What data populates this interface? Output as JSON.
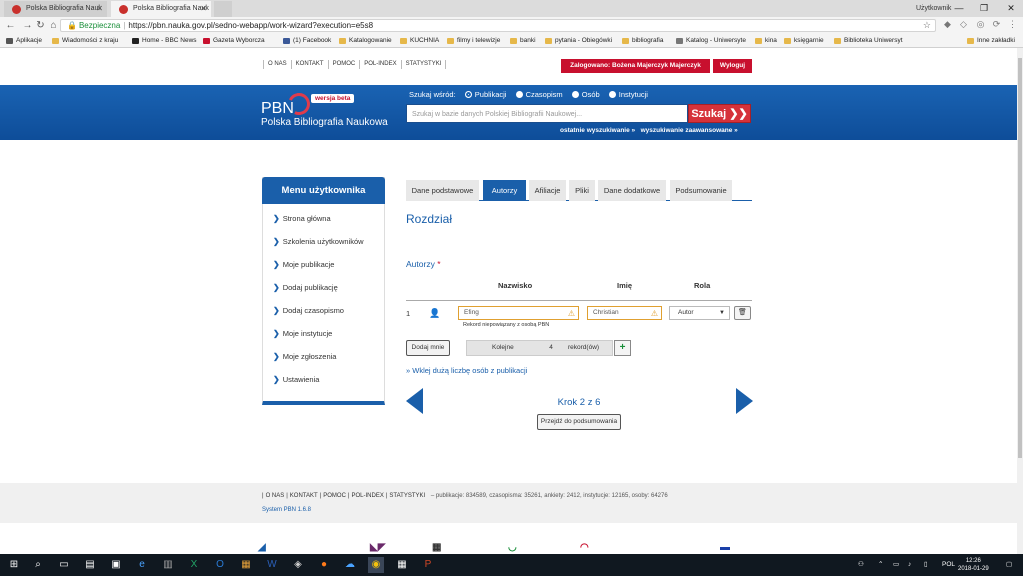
{
  "browser": {
    "tabs": [
      {
        "title": "Polska Bibliografia Nauk"
      },
      {
        "title": "Polska Bibliografia Nauk"
      }
    ],
    "user": "Użytkownik",
    "address": {
      "secure_label": "Bezpieczna",
      "url": "https://pbn.nauka.gov.pl/sedno-webapp/work-wizard?execution=e5s8"
    },
    "bookmarks": [
      "Aplikacje",
      "Wiadomości z kraju",
      "Home - BBC News",
      "Gazeta Wyborcza",
      "(1) Facebook",
      "Katalogowanie",
      "KUCHNIA",
      "filmy i telewizje",
      "banki",
      "pytania - Obiegówki",
      "bibliografia",
      "Katalog - Uniwersyte",
      "kina",
      "księgarnie",
      "Biblioteka Uniwersyt",
      "Inne zakładki"
    ]
  },
  "topnav": {
    "links": [
      "O NAS",
      "KONTAKT",
      "POMOC",
      "POL-INDEX",
      "STATYSTYKI"
    ],
    "logged_in": "Zalogowano: Bożena Majerczyk Majerczyk",
    "logout": "Wyloguj"
  },
  "banner": {
    "logo": "PBN",
    "beta": "wersja beta",
    "full_name": "Polska Bibliografia Naukowa",
    "search_label": "Szukaj wśród:",
    "radios": [
      "Publikacji",
      "Czasopism",
      "Osób",
      "Instytucji"
    ],
    "search_placeholder": "Szukaj w bazie danych Polskiej Bibliografii Naukowej...",
    "search_button": "Szukaj",
    "recent": "ostatnie wyszukiwanie »",
    "advanced": "wyszukiwanie zaawansowane »"
  },
  "menu": {
    "title": "Menu użytkownika",
    "items": [
      "Strona główna",
      "Szkolenia użytkowników",
      "Moje publikacje",
      "Dodaj publikację",
      "Dodaj czasopismo",
      "Moje instytucje",
      "Moje zgłoszenia",
      "Ustawienia"
    ]
  },
  "wizard": {
    "tabs": [
      "Dane podstawowe",
      "Autorzy",
      "Afiliacje",
      "Pliki",
      "Dane dodatkowe",
      "Podsumowanie"
    ],
    "heading": "Rozdział",
    "authors_label": "Autorzy",
    "required_mark": "*",
    "columns": [
      "Nazwisko",
      "Imię",
      "Rola"
    ],
    "row": {
      "number": "1",
      "surname": "Efing",
      "firstname": "Christian",
      "role": "Autor",
      "note": "Rekord niepowiązany z osobą PBN"
    },
    "add_button": "Dodaj mnie",
    "next_label": "Kolejne",
    "next_count": "4",
    "next_unit": "rekord(ów)",
    "paste_link": "» Wklej dużą liczbę osób z publikacji",
    "step": "Krok 2 z 6",
    "summary_button": "Przejdź do podsumowania"
  },
  "footer": {
    "links": [
      "O NAS",
      "KONTAKT",
      "POMOC",
      "POL-INDEX",
      "STATYSTYKI"
    ],
    "stats": "– publikacje: 834589, czasopisma: 35261, ankiety: 2412, instytucje: 12165, osoby: 64276",
    "system": "System PBN 1.6.8"
  },
  "taskbar": {
    "language": "POL",
    "time": "12:26",
    "date": "2018-01-29"
  },
  "colors": {
    "primary": "#1a5faa",
    "accent": "#c8102e",
    "warning": "#e0a030"
  }
}
